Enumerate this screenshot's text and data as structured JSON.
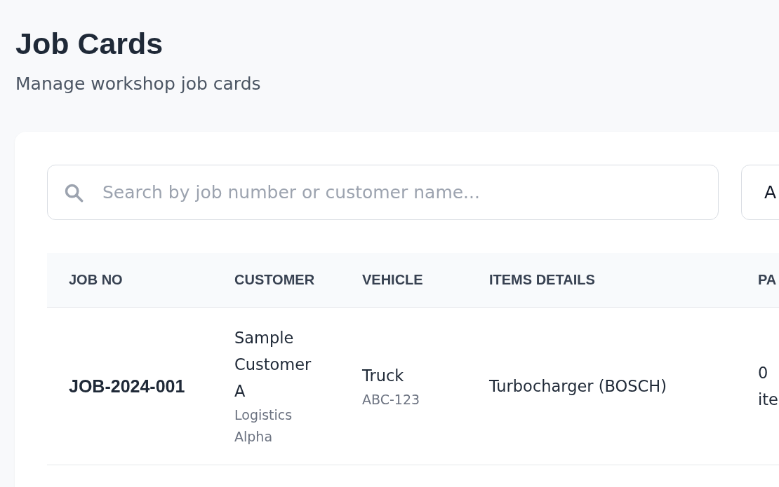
{
  "header": {
    "title": "Job Cards",
    "subtitle": "Manage workshop job cards"
  },
  "search": {
    "placeholder": "Search by job number or customer name..."
  },
  "filter": {
    "value": "A"
  },
  "table": {
    "columns": [
      "JOB NO",
      "CUSTOMER",
      "VEHICLE",
      "ITEMS DETAILS",
      "PA"
    ],
    "rows": [
      {
        "job_no": "JOB-2024-001",
        "customer": "Sample Customer A",
        "company": "Logistics Alpha",
        "vehicle": "Truck",
        "plate": "ABC-123",
        "items": "Turbocharger (BOSCH)",
        "column_5": "0 ite"
      }
    ]
  }
}
